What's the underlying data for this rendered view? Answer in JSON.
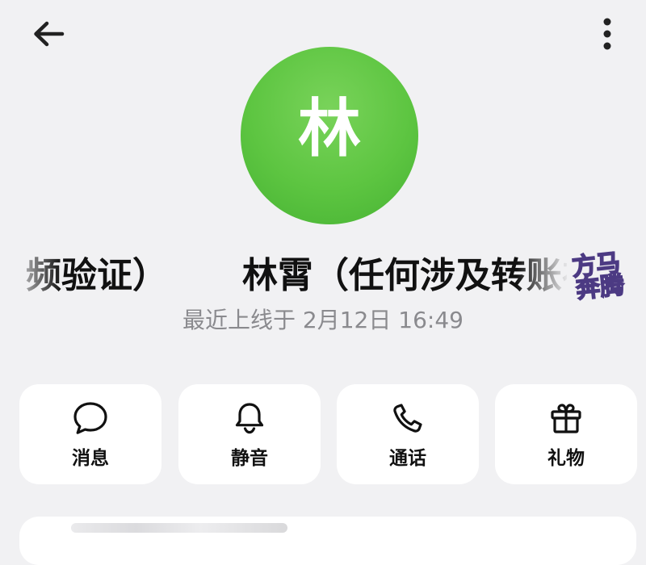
{
  "profile": {
    "avatar_text": "林",
    "display_name": "频验证）      林霄（任何涉及转账礼",
    "last_seen": "最近上线于 2月12日 16:49",
    "sticker": {
      "line1": "方马",
      "line2": "奔腾"
    }
  },
  "actions": [
    {
      "label": "消息",
      "icon": "chat-bubble-icon"
    },
    {
      "label": "静音",
      "icon": "bell-icon"
    },
    {
      "label": "通话",
      "icon": "phone-icon"
    },
    {
      "label": "礼物",
      "icon": "gift-icon"
    }
  ],
  "colors": {
    "background": "#f1f1f3",
    "avatar": "#5dc541",
    "card": "#ffffff",
    "muted_text": "#8a8a8e"
  }
}
